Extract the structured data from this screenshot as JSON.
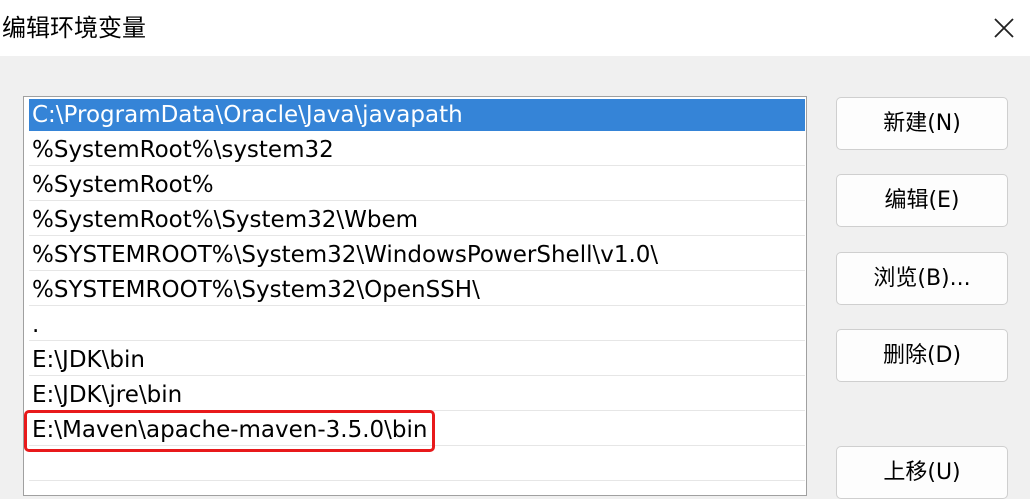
{
  "window": {
    "title": "编辑环境变量",
    "close_glyph": "close-icon"
  },
  "path_list": {
    "selected_index": 0,
    "highlighted_index": 9,
    "highlight_color": "#e8191b",
    "selection_color": "#3584d7",
    "items": [
      "C:\\ProgramData\\Oracle\\Java\\javapath",
      "%SystemRoot%\\system32",
      "%SystemRoot%",
      "%SystemRoot%\\System32\\Wbem",
      "%SYSTEMROOT%\\System32\\WindowsPowerShell\\v1.0\\",
      "%SYSTEMROOT%\\System32\\OpenSSH\\",
      ".",
      "E:\\JDK\\bin",
      "E:\\JDK\\jre\\bin",
      "E:\\Maven\\apache-maven-3.5.0\\bin"
    ]
  },
  "buttons": {
    "new_label": "新建(N)",
    "edit_label": "编辑(E)",
    "browse_label": "浏览(B)...",
    "delete_label": "删除(D)",
    "move_up_label": "上移(U)"
  }
}
